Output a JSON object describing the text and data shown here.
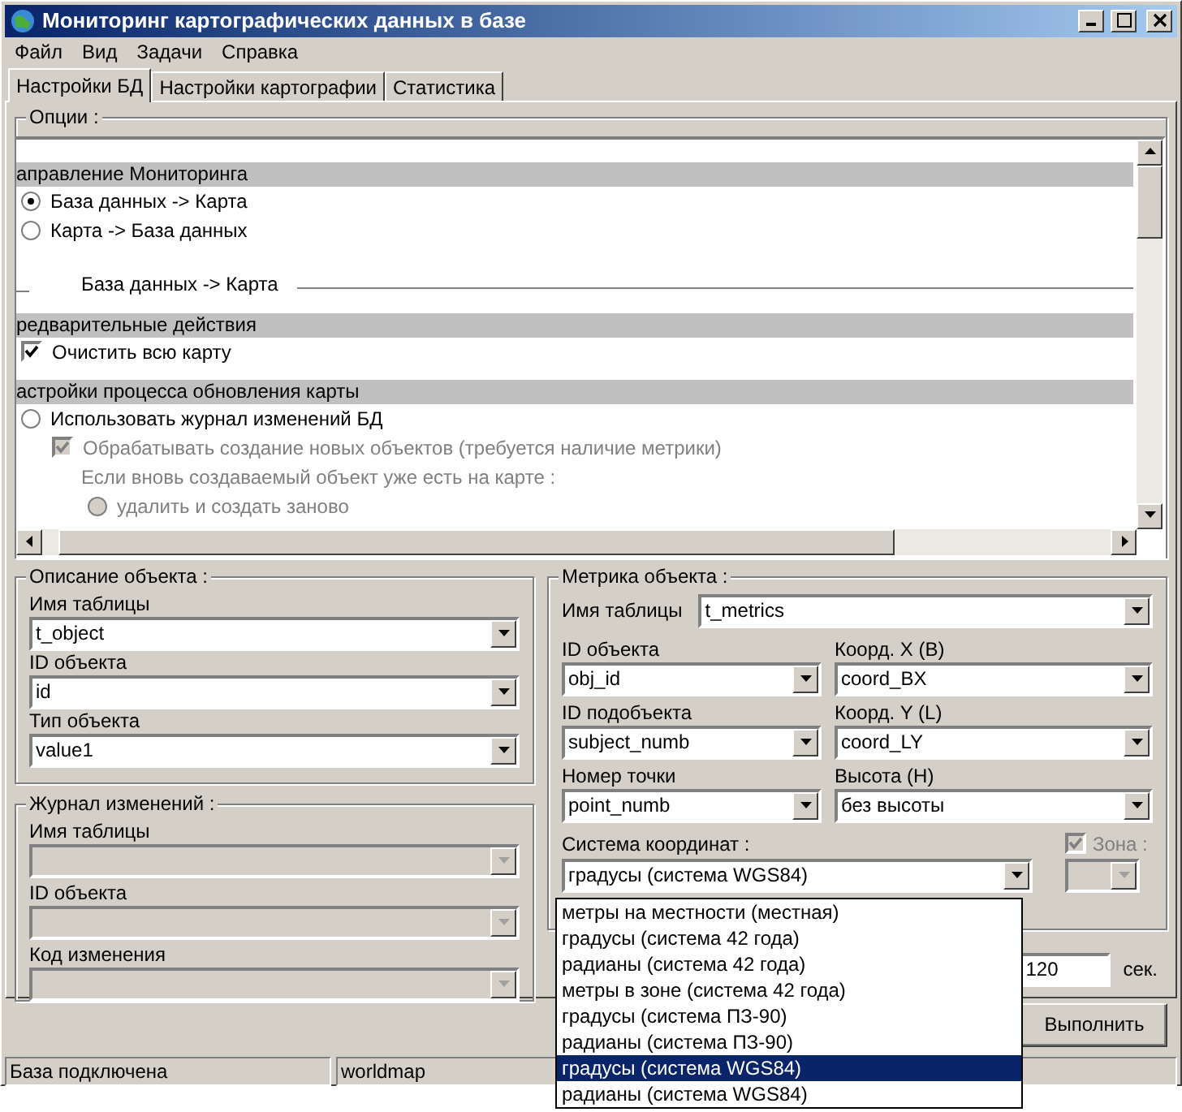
{
  "window": {
    "title": "Мониторинг картографических данных в базе"
  },
  "menu": [
    "Файл",
    "Вид",
    "Задачи",
    "Справка"
  ],
  "tabs": [
    {
      "label": "Настройки БД",
      "selected": true
    },
    {
      "label": "Настройки картографии",
      "selected": false
    },
    {
      "label": "Статистика",
      "selected": false
    }
  ],
  "options": {
    "title": "Опции :",
    "items": [
      {
        "kind": "header",
        "label": "аправление Мониторинга"
      },
      {
        "kind": "radio",
        "label": "База данных -> Карта",
        "selected": true,
        "disabled": false
      },
      {
        "kind": "radio",
        "label": "Карта -> База данных",
        "selected": false,
        "disabled": false
      },
      {
        "kind": "divider",
        "label": "База данных -> Карта"
      },
      {
        "kind": "header",
        "label": "редварительные действия"
      },
      {
        "kind": "checkbox",
        "label": "Очистить всю карту",
        "checked": true,
        "disabled": false
      },
      {
        "kind": "header",
        "label": "астройки процесса обновления карты"
      },
      {
        "kind": "radio",
        "label": "Использовать журнал изменений БД",
        "selected": false,
        "disabled": false
      },
      {
        "kind": "checkbox",
        "label": "Обрабатывать создание новых объектов (требуется наличие метрики)",
        "checked": true,
        "disabled": true
      },
      {
        "kind": "note",
        "label": "Если вновь создаваемый объект уже есть на карте :"
      },
      {
        "kind": "radio",
        "label": "удалить и создать заново",
        "selected": false,
        "disabled": true
      }
    ]
  },
  "object_description": {
    "title": "Описание объекта :",
    "fields": [
      {
        "label": "Имя таблицы",
        "value": "t_object",
        "disabled": false
      },
      {
        "label": "ID объекта",
        "value": "id",
        "disabled": false
      },
      {
        "label": "Тип объекта",
        "value": "value1",
        "disabled": false
      }
    ]
  },
  "change_log": {
    "title": "Журнал изменений :",
    "fields": [
      {
        "label": "Имя таблицы",
        "disabled": true
      },
      {
        "label": "ID объекта",
        "disabled": true
      },
      {
        "label": "Код изменения",
        "disabled": true
      }
    ]
  },
  "object_metrics": {
    "title": "Метрика объекта :",
    "table": {
      "label": "Имя таблицы",
      "value": "t_metrics"
    },
    "fields": [
      {
        "label": "ID объекта",
        "value": "obj_id"
      },
      {
        "label": "Коорд. X (B)",
        "value": "coord_BX"
      },
      {
        "label": "ID подобъекта",
        "value": "subject_numb"
      },
      {
        "label": "Коорд. Y (L)",
        "value": "coord_LY"
      },
      {
        "label": "Номер точки",
        "value": "point_numb"
      },
      {
        "label": "Высота (H)",
        "value": "без высоты"
      }
    ],
    "coordinate_system": {
      "label": "Система координат :",
      "value": "градусы (система WGS84)",
      "expanded": true,
      "options": [
        {
          "label": "метры на местности (местная)",
          "selected": false
        },
        {
          "label": "градусы (система 42 года)",
          "selected": false
        },
        {
          "label": "радианы (система 42 года)",
          "selected": false
        },
        {
          "label": "метры в зоне (система 42 года)",
          "selected": false
        },
        {
          "label": "градусы (система ПЗ-90)",
          "selected": false
        },
        {
          "label": "радианы (система ПЗ-90)",
          "selected": false
        },
        {
          "label": "градусы (система WGS84)",
          "selected": true
        },
        {
          "label": "радианы (система WGS84)",
          "selected": false
        }
      ]
    },
    "zone": {
      "label": "Зона :",
      "checked": true,
      "disabled": true
    }
  },
  "interval": {
    "value": "120",
    "unit": "сек."
  },
  "run_button": "Выполнить",
  "status_bar": [
    "База подключена",
    "worldmap"
  ]
}
